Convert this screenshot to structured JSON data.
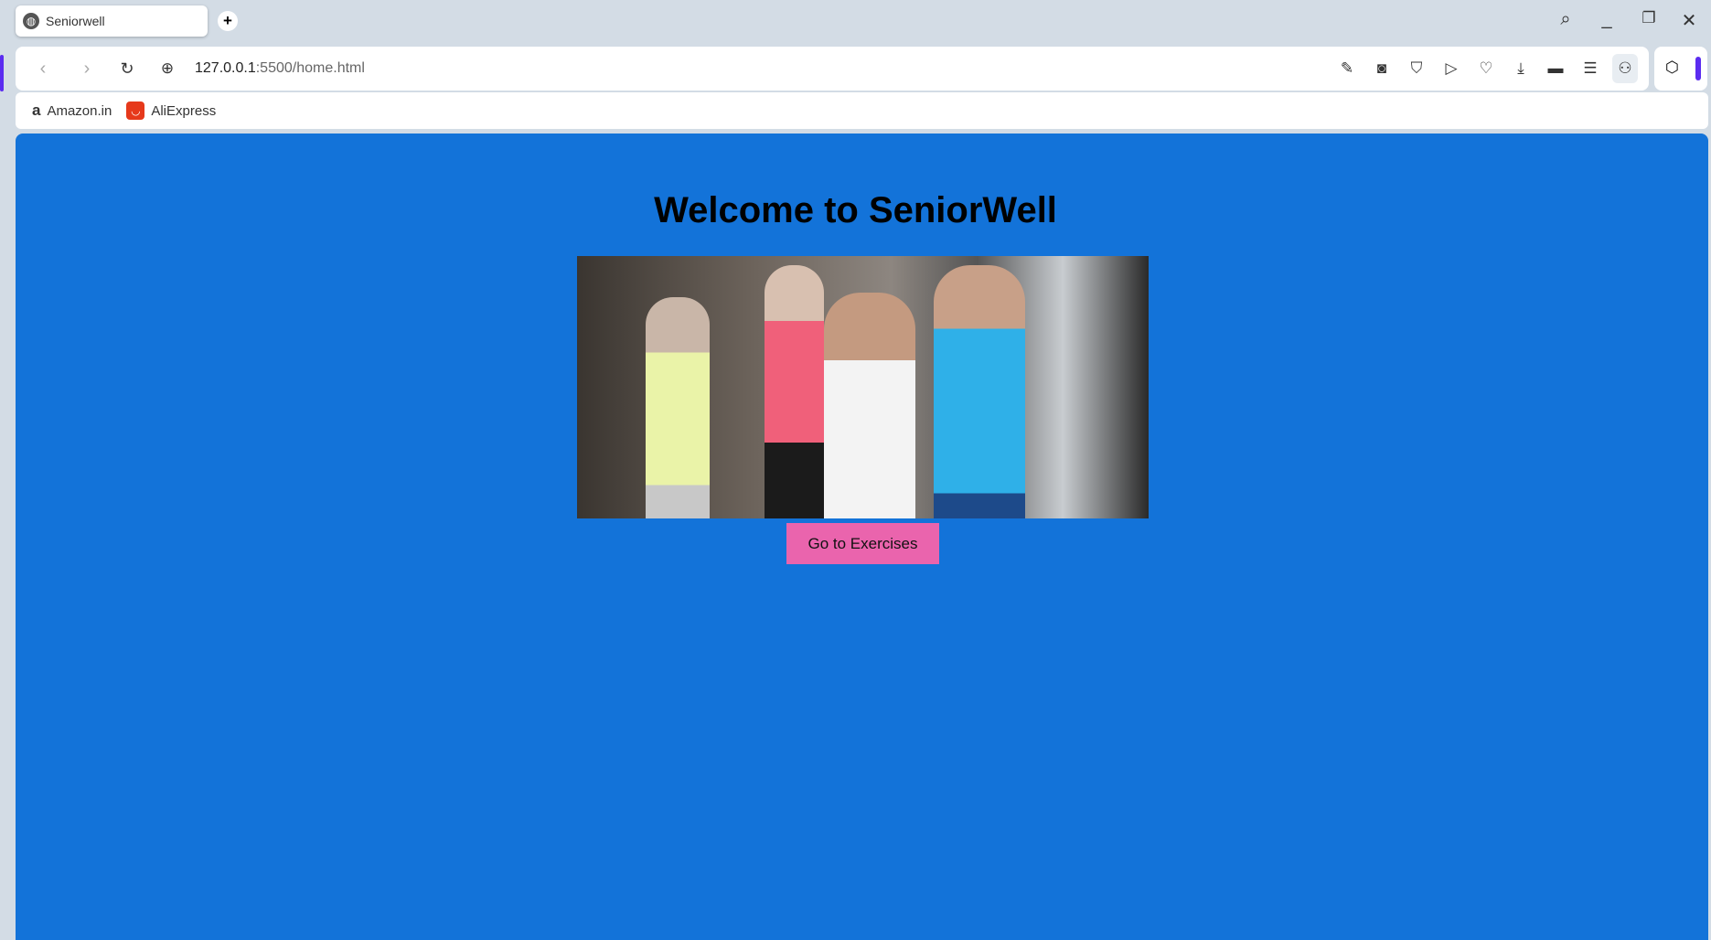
{
  "browser": {
    "tab_title": "Seniorwell",
    "url_host": "127.0.0.1",
    "url_path": ":5500/home.html",
    "bookmarks": [
      {
        "label": "Amazon.in"
      },
      {
        "label": "AliExpress"
      }
    ]
  },
  "page": {
    "heading": "Welcome to SeniorWell",
    "image_alt": "Seniors exercising in a gym",
    "button_label": "Go to Exercises"
  },
  "colors": {
    "background": "#1373d9",
    "button": "#ea64ad"
  }
}
